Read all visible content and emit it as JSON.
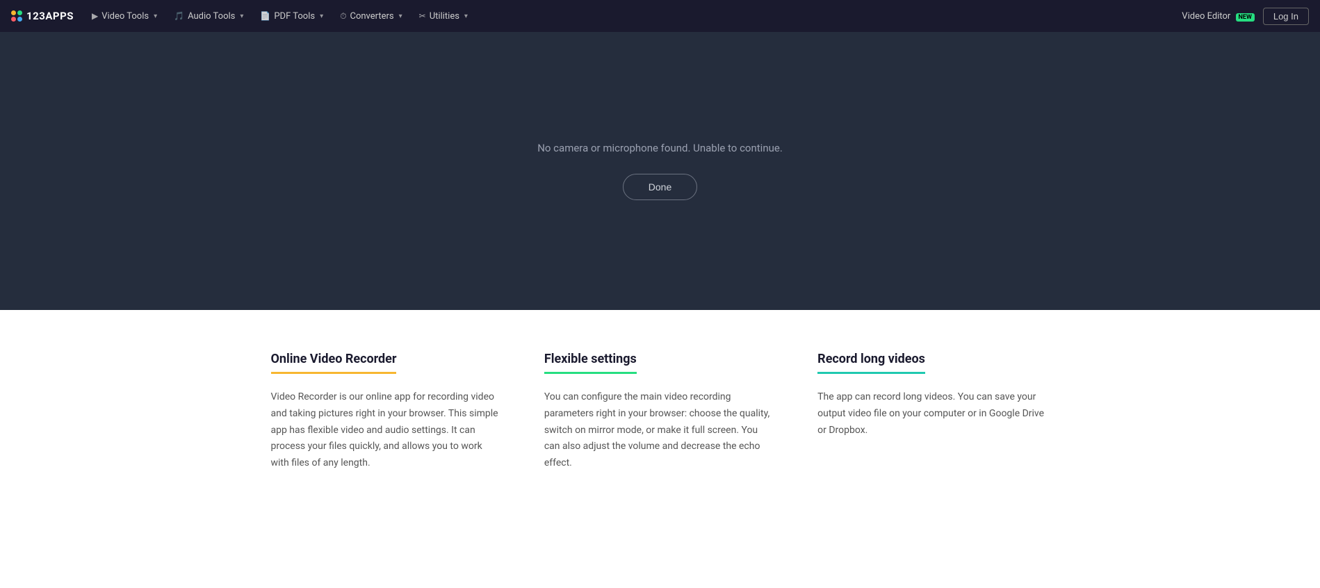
{
  "navbar": {
    "logo_text": "123APPS",
    "items": [
      {
        "id": "video-tools",
        "label": "Video Tools",
        "icon": "▶"
      },
      {
        "id": "audio-tools",
        "label": "Audio Tools",
        "icon": "🎵"
      },
      {
        "id": "pdf-tools",
        "label": "PDF Tools",
        "icon": "📄"
      },
      {
        "id": "converters",
        "label": "Converters",
        "icon": "⏱"
      },
      {
        "id": "utilities",
        "label": "Utilities",
        "icon": "✂"
      }
    ],
    "right": {
      "video_editor_label": "Video Editor",
      "new_badge": "NEW",
      "login_label": "Log In"
    }
  },
  "video_area": {
    "message": "No camera or microphone found. Unable to continue.",
    "done_button": "Done"
  },
  "features": [
    {
      "id": "online-video-recorder",
      "title": "Online Video Recorder",
      "title_class": "yellow",
      "description": "Video Recorder is our online app for recording video and taking pictures right in your browser. This simple app has flexible video and audio settings. It can process your files quickly, and allows you to work with files of any length."
    },
    {
      "id": "flexible-settings",
      "title": "Flexible settings",
      "title_class": "green",
      "description": "You can configure the main video recording parameters right in your browser: choose the quality, switch on mirror mode, or make it full screen. You can also adjust the volume and decrease the echo effect."
    },
    {
      "id": "record-long-videos",
      "title": "Record long videos",
      "title_class": "teal",
      "description": "The app can record long videos. You can save your output video file on your computer or in Google Drive or Dropbox."
    }
  ]
}
